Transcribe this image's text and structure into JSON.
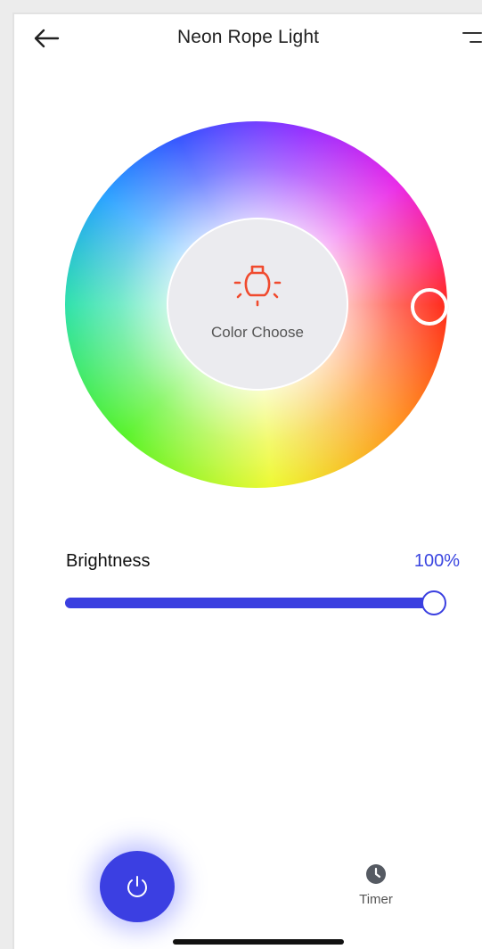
{
  "header": {
    "title": "Neon Rope Light",
    "back_icon": "arrow-left-icon",
    "menu_icon": "menu-icon"
  },
  "color_wheel": {
    "center_label": "Color Choose",
    "center_icon": "bulb-icon",
    "center_icon_color": "#f04a2e",
    "selected_color": "#ff1f0f"
  },
  "brightness": {
    "label": "Brightness",
    "value_text": "100%",
    "value": 1.0,
    "accent": "#3a3fe0"
  },
  "bottom_bar": {
    "power_icon": "power-icon",
    "timer_icon": "clock-icon",
    "timer_label": "Timer"
  }
}
